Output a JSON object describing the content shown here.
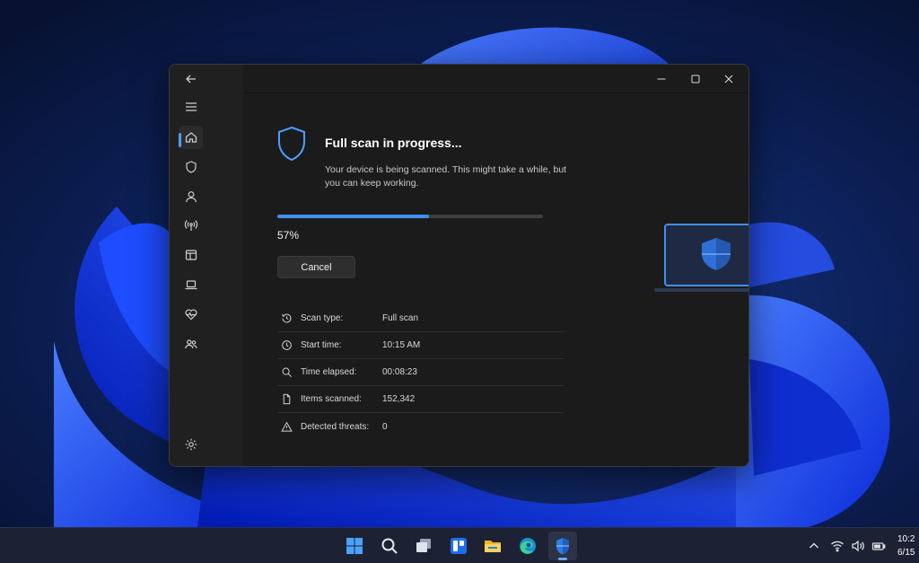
{
  "window": {
    "close_label": "Close",
    "maximize_label": "Maximize",
    "minimize_label": "Minimize"
  },
  "sidebar": {
    "items": [
      {
        "name": "home",
        "icon": "home-icon",
        "active": true
      },
      {
        "name": "virus-protection",
        "icon": "shield-icon"
      },
      {
        "name": "account-protection",
        "icon": "person-icon"
      },
      {
        "name": "firewall-network",
        "icon": "antenna-icon"
      },
      {
        "name": "app-browser-control",
        "icon": "app-window-icon"
      },
      {
        "name": "device-security",
        "icon": "laptop-icon"
      },
      {
        "name": "device-performance",
        "icon": "heart-pulse-icon"
      },
      {
        "name": "family-options",
        "icon": "people-icon"
      }
    ],
    "settings_icon": "gear-icon"
  },
  "scan": {
    "title": "Full scan in progress...",
    "description": "Your device is being scanned. This might take a while, but you can keep working.",
    "progress_percent": 57,
    "progress_label": "57%",
    "cancel_label": "Cancel",
    "details": [
      {
        "icon": "history-icon",
        "label": "Scan type:",
        "value": "Full scan"
      },
      {
        "icon": "clock-icon",
        "label": "Start time:",
        "value": "10:15 AM"
      },
      {
        "icon": "search-icon",
        "label": "Time elapsed:",
        "value": "00:08:23"
      },
      {
        "icon": "document-icon",
        "label": "Items scanned:",
        "value": "152,342"
      },
      {
        "icon": "warning-icon",
        "label": "Detected threats:",
        "value": "0"
      }
    ]
  },
  "taskbar": {
    "apps": [
      "windows-start-icon",
      "search-icon",
      "task-view-icon",
      "widgets-icon",
      "file-explorer-icon",
      "edge-icon",
      "windows-security-icon"
    ],
    "clock_time": "10:2",
    "clock_date": "6/15"
  },
  "colors": {
    "accent": "#3f8ff0",
    "window_bg": "#1b1b1b",
    "sidebar_bg": "#202020"
  }
}
